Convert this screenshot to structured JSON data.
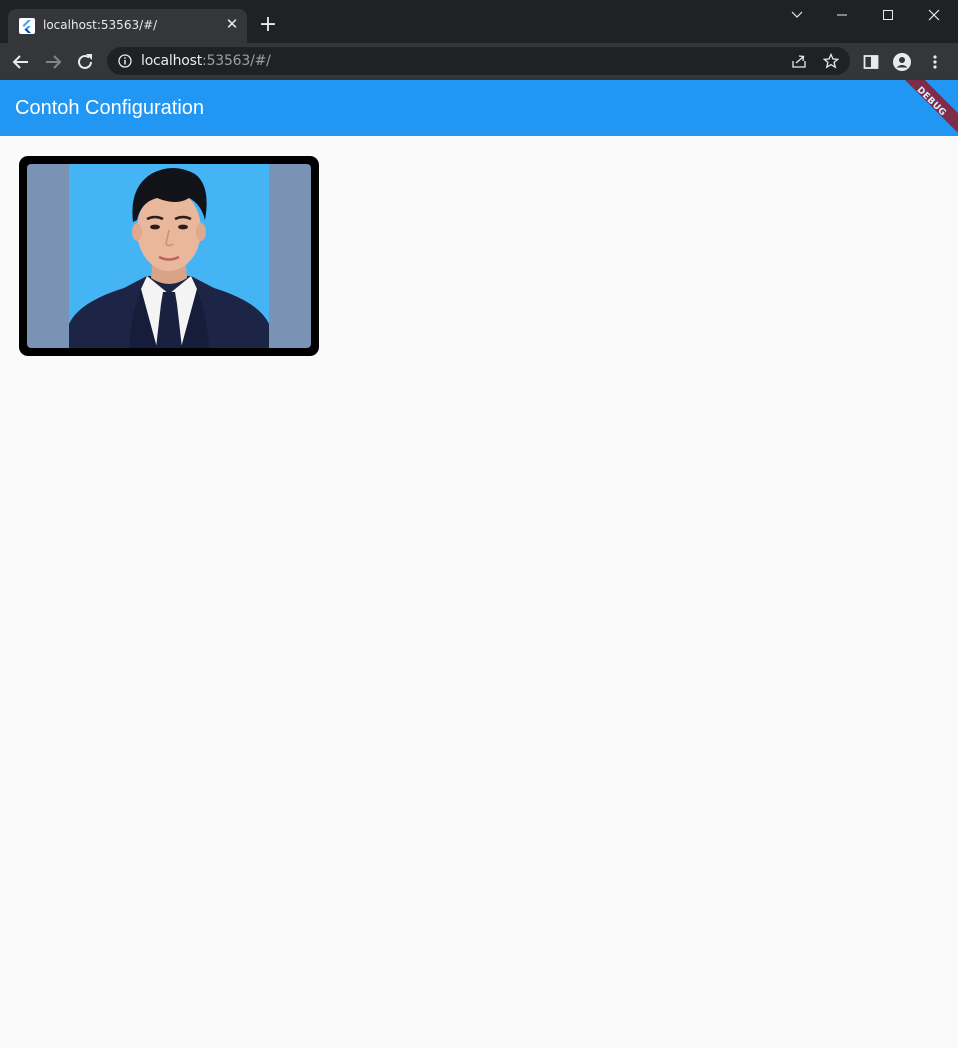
{
  "browser": {
    "tab": {
      "title": "localhost:53563/#/"
    },
    "url": {
      "host": "localhost",
      "rest": ":53563/#/"
    }
  },
  "app": {
    "title": "Contoh Configuration",
    "debug_banner": "DEBUG",
    "colors": {
      "appbar": "#2196f3",
      "background": "#fafafa",
      "card_border": "#000000",
      "photo_backdrop": "#45b4f5",
      "photo_side": "#7a93b5"
    }
  },
  "icons": [
    "flutter-favicon-icon",
    "close-icon",
    "plus-icon",
    "chevron-down-icon",
    "minimize-icon",
    "maximize-icon",
    "window-close-icon",
    "back-arrow-icon",
    "forward-arrow-icon",
    "reload-icon",
    "info-icon",
    "share-icon",
    "star-icon",
    "side-panel-icon",
    "profile-icon",
    "kebab-menu-icon"
  ]
}
